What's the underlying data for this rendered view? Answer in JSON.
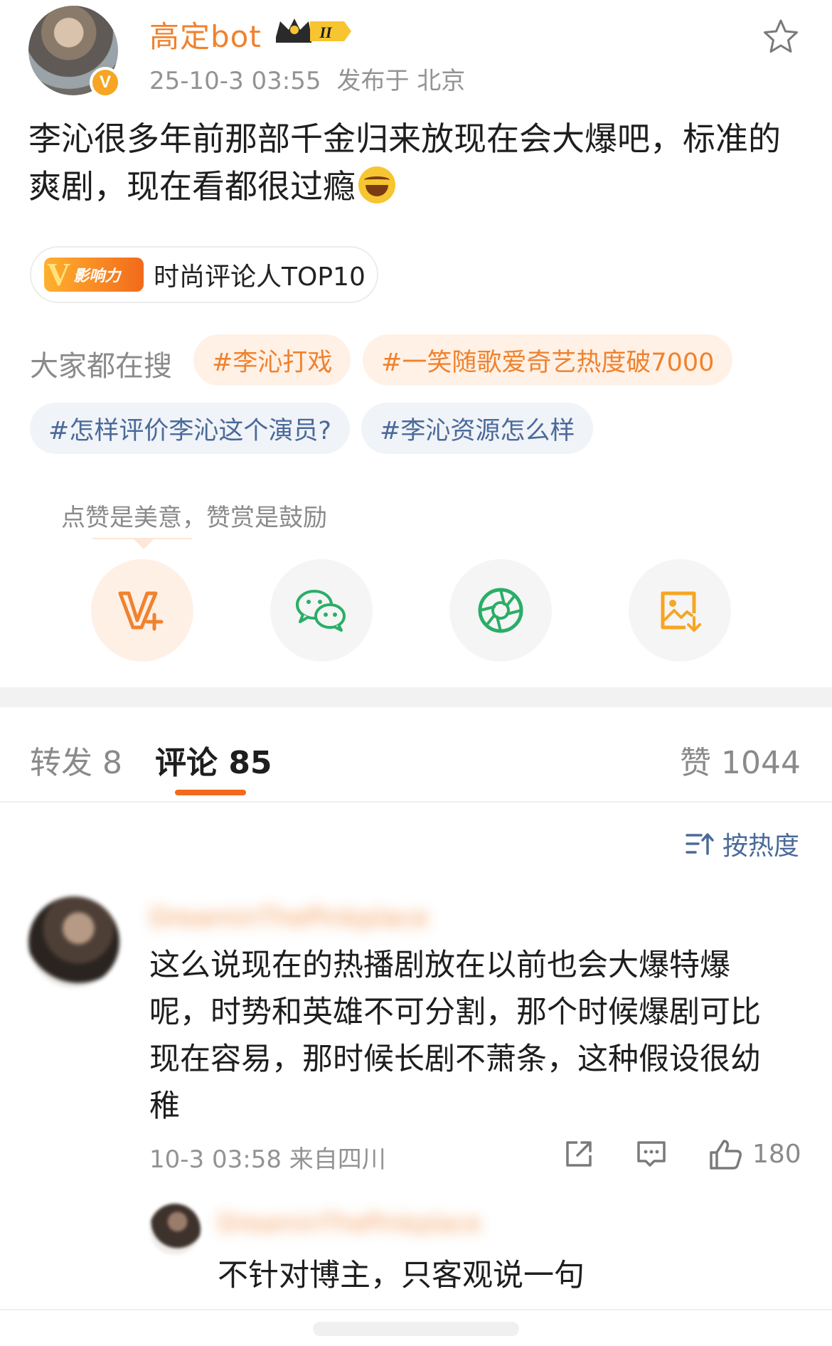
{
  "post": {
    "username": "高定bot",
    "level_badge": "II",
    "time": "25-10-3 03:55",
    "location": "发布于 北京",
    "text": "李沁很多年前那部千金归来放现在会大爆吧，标准的爽剧，现在看都很过瘾",
    "emoji": "laughing-tears-emoji",
    "influence_badge_label": "影响力",
    "influence_badge_text": "时尚评论人TOP10"
  },
  "search": {
    "label": "大家都在搜",
    "tags": [
      "#李沁打戏",
      "#一笑随歌爱奇艺热度破7000",
      "#怎样评价李沁这个演员?",
      "#李沁资源怎么样"
    ]
  },
  "reward": {
    "hint": "点赞是美意，赞赏是鼓励",
    "buttons": [
      "v-plus-icon",
      "wechat-icon",
      "moments-icon",
      "save-image-icon"
    ]
  },
  "tabs": {
    "repost": "转发 8",
    "comment": "评论 85",
    "like": "赞 1044"
  },
  "sort": {
    "label": "按热度"
  },
  "comment": {
    "username": "DreaminThePinkplace",
    "text": "这么说现在的热播剧放在以前也会大爆特爆呢，时势和英雄不可分割，那个时候爆剧可比现在容易，那时候长剧不萧条，这种假设很幼稚",
    "time_location": "10-3 03:58 来自四川",
    "likes": "180"
  },
  "reply": {
    "username": "DreaminThePinkplace",
    "text": "不针对博主，只客观说一句"
  },
  "colors": {
    "accent": "#f0822e",
    "tag_blue": "#4a6a9a",
    "tab_underline": "#f26a1b"
  }
}
